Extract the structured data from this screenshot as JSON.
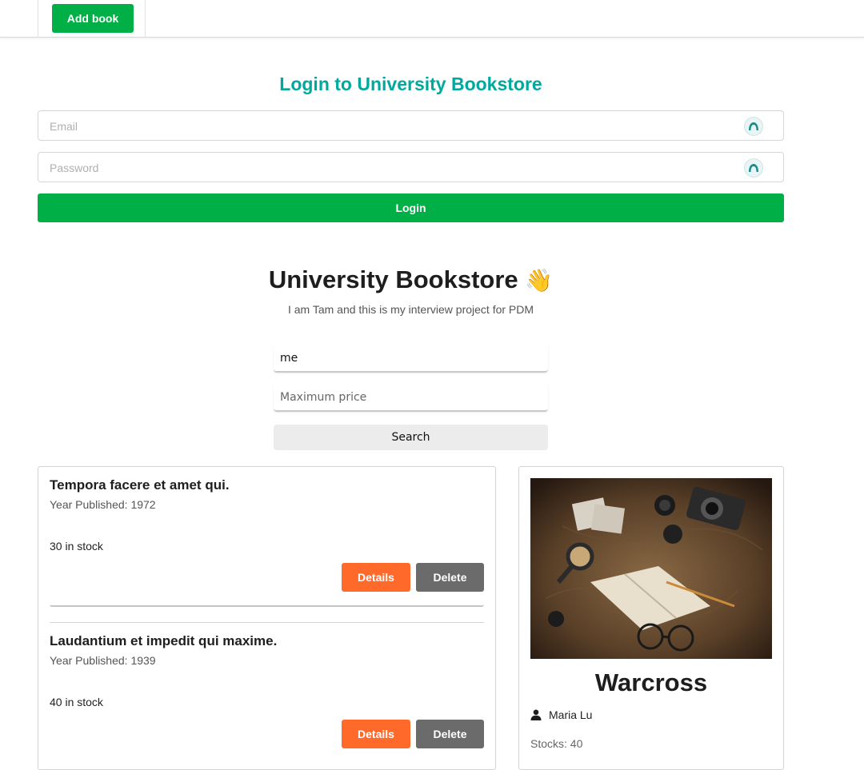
{
  "topbar": {
    "add_book_label": "Add book"
  },
  "login": {
    "title": "Login to University Bookstore",
    "email_placeholder": "Email",
    "password_placeholder": "Password",
    "login_label": "Login",
    "autofill_icon": "password-manager-icon"
  },
  "header": {
    "title": "University Bookstore",
    "emoji": "👋",
    "subtitle": "I am Tam and this is my interview project for PDM"
  },
  "search": {
    "query_value": "me",
    "max_price_placeholder": "Maximum price",
    "search_label": "Search"
  },
  "books": [
    {
      "title": "Tempora facere et amet qui.",
      "year": "Year Published: 1972",
      "stock": "30 in stock",
      "details_label": "Details",
      "delete_label": "Delete"
    },
    {
      "title": "Laudantium et impedit qui maxime.",
      "year": "Year Published: 1939",
      "stock": "40 in stock",
      "details_label": "Details",
      "delete_label": "Delete"
    }
  ],
  "featured": {
    "title": "Warcross",
    "author": "Maria Lu",
    "stocks": "Stocks: 40",
    "image": "book-and-camera-on-map-photo"
  },
  "colors": {
    "green": "#00b046",
    "teal": "#00a99d",
    "orange": "#ff6a2b",
    "gray_button": "#6b6b6b"
  }
}
